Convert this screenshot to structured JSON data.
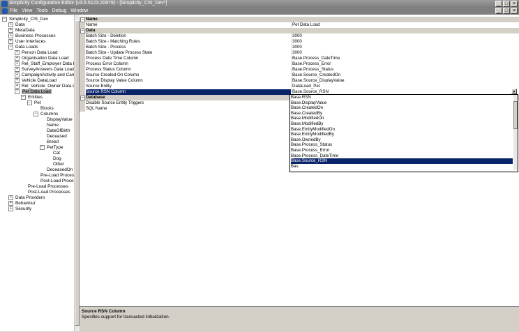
{
  "window": {
    "title": "Simplicity Configuration Editor (v3.5.5123.20879) - [Simplicity_CIS_Dev*]",
    "min": "_",
    "max": "□",
    "close": "×"
  },
  "menubar": {
    "items": [
      "File",
      "View",
      "Tools",
      "Debug",
      "Window"
    ],
    "min": "_",
    "max": "□",
    "close": "×"
  },
  "tree": {
    "items": [
      {
        "label": "Simplicity_CIS_Dev",
        "indent": 0,
        "exp": "−"
      },
      {
        "label": "Data",
        "indent": 1,
        "exp": "+"
      },
      {
        "label": "MetaData",
        "indent": 1,
        "exp": "+"
      },
      {
        "label": "Business Processes",
        "indent": 1,
        "exp": "+"
      },
      {
        "label": "User Interfaces",
        "indent": 1,
        "exp": "+"
      },
      {
        "label": "Data Loads",
        "indent": 1,
        "exp": "−"
      },
      {
        "label": "Person Data Load",
        "indent": 2,
        "exp": "+"
      },
      {
        "label": "Organisation Data Load",
        "indent": 2,
        "exp": "+"
      },
      {
        "label": "Rel_Staff_Employer Data Load",
        "indent": 2,
        "exp": "+"
      },
      {
        "label": "SurveyAnswers Data Load",
        "indent": 2,
        "exp": "+"
      },
      {
        "label": "CampaignActivity and Campaign",
        "indent": 2,
        "exp": "+"
      },
      {
        "label": "Vehicle DataLoad",
        "indent": 2,
        "exp": "+"
      },
      {
        "label": "Rel_Vehicle_Owner Data Load",
        "indent": 2,
        "exp": "+"
      },
      {
        "label": "Pet Data Load",
        "indent": 2,
        "exp": "−",
        "selected": true
      },
      {
        "label": "Entities",
        "indent": 3,
        "exp": "−"
      },
      {
        "label": "Pet",
        "indent": 4,
        "exp": "−"
      },
      {
        "label": "Blocks",
        "indent": 5,
        "exp": ""
      },
      {
        "label": "Columns",
        "indent": 5,
        "exp": "−"
      },
      {
        "label": "DisplayValue",
        "indent": 6,
        "exp": ""
      },
      {
        "label": "Name",
        "indent": 6,
        "exp": ""
      },
      {
        "label": "DateOfBirth",
        "indent": 6,
        "exp": ""
      },
      {
        "label": "Deceased",
        "indent": 6,
        "exp": ""
      },
      {
        "label": "Breed",
        "indent": 6,
        "exp": ""
      },
      {
        "label": "PetType",
        "indent": 6,
        "exp": "−"
      },
      {
        "label": "Cat",
        "indent": 7,
        "exp": ""
      },
      {
        "label": "Dog",
        "indent": 7,
        "exp": ""
      },
      {
        "label": "Other",
        "indent": 7,
        "exp": ""
      },
      {
        "label": "DeceasedOn",
        "indent": 6,
        "exp": ""
      },
      {
        "label": "Pre-Load Processes",
        "indent": 5,
        "exp": ""
      },
      {
        "label": "Post-Load Processes",
        "indent": 5,
        "exp": ""
      },
      {
        "label": "Pre-Load Processes",
        "indent": 3,
        "exp": ""
      },
      {
        "label": "Post-Load Processes",
        "indent": 3,
        "exp": ""
      },
      {
        "label": "Data Providers",
        "indent": 1,
        "exp": "+"
      },
      {
        "label": "Behaviour",
        "indent": 1,
        "exp": "+"
      },
      {
        "label": "Security",
        "indent": 1,
        "exp": "+"
      }
    ]
  },
  "grid": {
    "rows": [
      {
        "kind": "cat",
        "name": "Name",
        "exp": "−"
      },
      {
        "kind": "prop",
        "name": "Name",
        "value": "Pet Data Load"
      },
      {
        "kind": "cat",
        "name": "Data",
        "exp": "−"
      },
      {
        "kind": "prop",
        "name": "Batch Size - Deletion",
        "value": "3000"
      },
      {
        "kind": "prop",
        "name": "Batch Size - Matching Rules",
        "value": "3000"
      },
      {
        "kind": "prop",
        "name": "Batch Size - Process",
        "value": "3000"
      },
      {
        "kind": "prop",
        "name": "Batch Size - Update Process State",
        "value": "3000"
      },
      {
        "kind": "prop",
        "name": "Process Date Time Column",
        "value": "Base.Process_DateTime"
      },
      {
        "kind": "prop",
        "name": "Process Error Column",
        "value": "Base.Process_Error"
      },
      {
        "kind": "prop",
        "name": "Process Status Column",
        "value": "Base.Process_Status"
      },
      {
        "kind": "prop",
        "name": "Source Created On Column",
        "value": "Base.Source_CreatedOn"
      },
      {
        "kind": "prop",
        "name": "Source Display Value Column",
        "value": "Base.Source_DisplayValue"
      },
      {
        "kind": "prop",
        "name": "Source Entity",
        "value": "DataLoad_Pet"
      },
      {
        "kind": "prop",
        "name": "Source RSN Column",
        "value": "Base.Source_RSN",
        "selected": true
      },
      {
        "kind": "cat",
        "name": "Database",
        "exp": "−"
      },
      {
        "kind": "prop",
        "name": "Disable Source Entity Triggers",
        "value": ""
      },
      {
        "kind": "prop",
        "name": "SQL Name",
        "value": ""
      }
    ],
    "dropdown_arrow": "▼"
  },
  "dropdown": {
    "options": [
      "Base.RSN",
      "Base.DisplayValue",
      "Base.CreatedOn",
      "Base.CreatedBy",
      "Base.ModifiedOn",
      "Base.ModifiedBy",
      "Base.EntityModifiedOn",
      "Base.EntityModifiedBy",
      "Base.OwnedBy",
      "Base.Process_Status",
      "Base.Process_Error",
      "Base.Process_DateTime",
      "Base.Source_RSN"
    ],
    "selected_index": 12,
    "partial": "Bas"
  },
  "help": {
    "title": "Source RSN Column",
    "description": "Specifies support for transacted initialization."
  }
}
